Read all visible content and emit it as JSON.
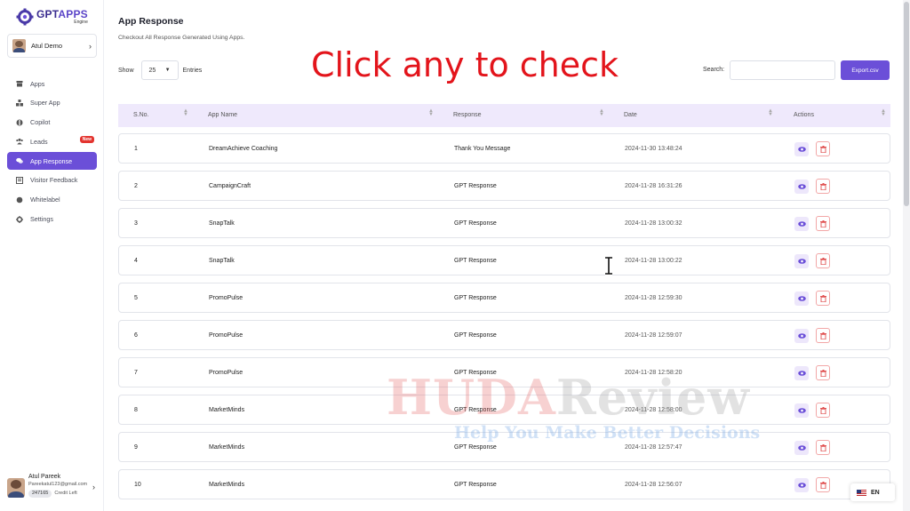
{
  "brand": {
    "name_part1": "GPT",
    "name_part2": "APPS",
    "subtitle": "Engine"
  },
  "account": {
    "name": "Atul Demo"
  },
  "nav": {
    "items": [
      {
        "label": "Apps",
        "icon": "box-icon"
      },
      {
        "label": "Super App",
        "icon": "boxes-icon"
      },
      {
        "label": "Copilot",
        "icon": "copilot-icon"
      },
      {
        "label": "Leads",
        "icon": "users-icon",
        "badge": "New"
      },
      {
        "label": "App Response",
        "icon": "chat-icon",
        "active": true
      },
      {
        "label": "Visitor Feedback",
        "icon": "feedback-icon"
      },
      {
        "label": "Whitelabel",
        "icon": "circle-icon"
      },
      {
        "label": "Settings",
        "icon": "gear-icon"
      }
    ]
  },
  "profile": {
    "name": "Atul Pareek",
    "email": "Pareekatul123@gmail.com",
    "credits": "247165",
    "credits_label": "Credit Left"
  },
  "page": {
    "title": "App Response",
    "subtitle": "Checkout All Response Generated Using Apps."
  },
  "overlay": {
    "text": "Click any to check"
  },
  "controls": {
    "show_label": "Show",
    "page_size": "25",
    "entries_label": "Entries",
    "search_label": "Search:",
    "search_value": "",
    "export_label": "Export.csv"
  },
  "table": {
    "headers": {
      "sno": "S.No.",
      "app": "App Name",
      "response": "Response",
      "date": "Date",
      "actions": "Actions"
    },
    "rows": [
      {
        "sno": "1",
        "app": "DreamAchieve Coaching",
        "response": "Thank You Message",
        "date": "2024-11-30 13:48:24"
      },
      {
        "sno": "2",
        "app": "CampaignCraft",
        "response": "GPT Response",
        "date": "2024-11-28 16:31:26"
      },
      {
        "sno": "3",
        "app": "SnapTalk",
        "response": "GPT Response",
        "date": "2024-11-28 13:00:32"
      },
      {
        "sno": "4",
        "app": "SnapTalk",
        "response": "GPT Response",
        "date": "2024-11-28 13:00:22"
      },
      {
        "sno": "5",
        "app": "PromoPulse",
        "response": "GPT Response",
        "date": "2024-11-28 12:59:30"
      },
      {
        "sno": "6",
        "app": "PromoPulse",
        "response": "GPT Response",
        "date": "2024-11-28 12:59:07"
      },
      {
        "sno": "7",
        "app": "PromoPulse",
        "response": "GPT Response",
        "date": "2024-11-28 12:58:20"
      },
      {
        "sno": "8",
        "app": "MarketMinds",
        "response": "GPT Response",
        "date": "2024-11-28 12:58:00"
      },
      {
        "sno": "9",
        "app": "MarketMinds",
        "response": "GPT Response",
        "date": "2024-11-28 12:57:47"
      },
      {
        "sno": "10",
        "app": "MarketMinds",
        "response": "GPT Response",
        "date": "2024-11-28 12:56:07"
      }
    ]
  },
  "watermark": {
    "part1": "HUDA",
    "part2": "Review",
    "tagline": "Help You Make Better Decisions"
  },
  "language": {
    "code": "EN"
  },
  "colors": {
    "accent": "#6b4fd8",
    "header_bg": "#efe9fc",
    "delete": "#e05353",
    "overlay": "#e3141b"
  }
}
